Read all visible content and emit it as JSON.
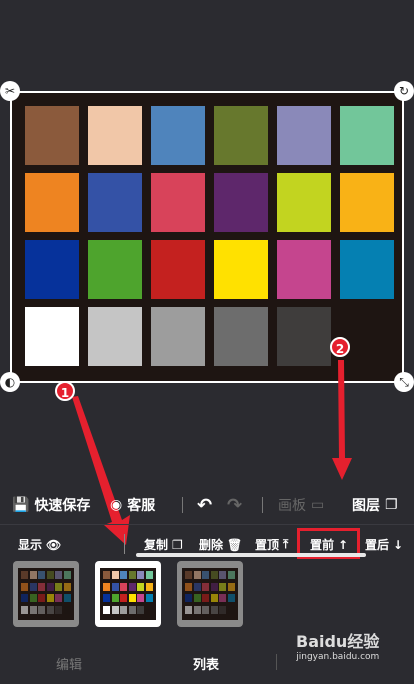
{
  "canvas": {
    "rows": [
      [
        "#8b5a3c",
        "#f1c7a8",
        "#4f84bc",
        "#67782d",
        "#8a89b9",
        "#72c69a"
      ],
      [
        "#ee8421",
        "#3452a6",
        "#d8435a",
        "#5e276b",
        "#c2d420",
        "#f9b216"
      ],
      [
        "#06329b",
        "#4ea42d",
        "#c4211f",
        "#ffe100",
        "#c5458e",
        "#0580b2"
      ],
      [
        "#ffffff",
        "#c5c5c5",
        "#9d9d9d",
        "#6d6d6d",
        "#3f3d3c",
        "#1e1512"
      ]
    ],
    "background": "#1e1512"
  },
  "annotations": {
    "marker_1": "1",
    "marker_2": "2",
    "color": "#e5202e"
  },
  "toolbar": {
    "save_label": "快速保存",
    "service_label": "客服",
    "undo_icon": "undo-icon",
    "redo_icon": "redo-icon",
    "board_label": "画板",
    "layer_label": "图层"
  },
  "actions": {
    "show_label": "显示",
    "copy_label": "复制",
    "delete_label": "删除",
    "top_label": "置顶",
    "forward_label": "置前",
    "backward_label": "置后"
  },
  "tabs": {
    "edit_label": "编辑",
    "list_label": "列表"
  },
  "watermark": {
    "logo": "Baidu经验",
    "url": "jingyan.baidu.com"
  }
}
